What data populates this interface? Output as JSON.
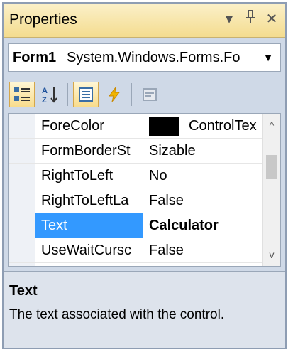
{
  "window": {
    "title": "Properties",
    "dropdown_icon": "▾",
    "pin_icon": "ᶦ",
    "close_icon": "✕"
  },
  "object_selector": {
    "name": "Form1",
    "type": "System.Windows.Forms.Fo",
    "selected_value": "Form1 System.Windows.Forms.Fo"
  },
  "toolbar": {
    "buttons": [
      "categorized-icon",
      "alphabetical-icon",
      "properties-icon",
      "events-icon",
      "property-pages-icon"
    ]
  },
  "grid": {
    "rows": [
      {
        "name": "ForeColor",
        "value": "ControlTex",
        "swatch": "#000000"
      },
      {
        "name": "FormBorderSt",
        "value": "Sizable"
      },
      {
        "name": "RightToLeft",
        "value": "No"
      },
      {
        "name": "RightToLeftLa",
        "value": "False"
      },
      {
        "name": "Text",
        "value": "Calculator",
        "selected": true
      },
      {
        "name": "UseWaitCursc",
        "value": "False"
      }
    ]
  },
  "description": {
    "title": "Text",
    "text": "The text associated with the control."
  },
  "colors": {
    "selection": "#3399ff",
    "title_bar": "#f4dc8f",
    "panel_background": "#cfd9e7"
  }
}
